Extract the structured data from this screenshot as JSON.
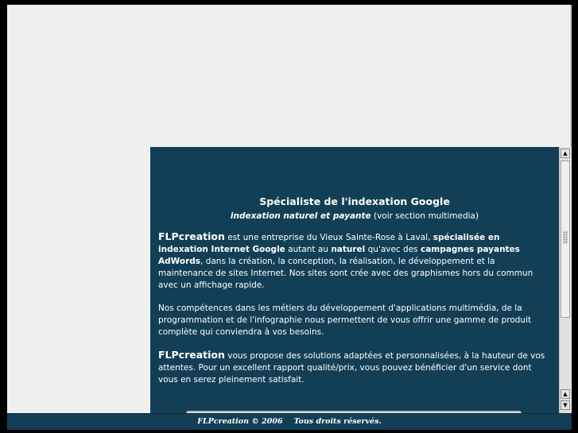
{
  "content": {
    "heading": "Spécialiste de l'indexation Google",
    "subheading_em": "indexation naturel et payante",
    "subheading_rest": " (voir section multimedia)",
    "p1": {
      "brand": "FLPcreation",
      "t1": " est une entreprise du Vieux Sainte-Rose à Laval, ",
      "b1": "spécialisée en indexation Internet Google",
      "t2": " autant au ",
      "b2": "naturel",
      "t3": " qu'avec des ",
      "b3": "campagnes payantes AdWords",
      "t4": ", dans la création, la conception, la réalisation, le développement et la maintenance de sites Internet. Nos sites sont crée avec des graphismes hors du commun avec un affichage rapide."
    },
    "p2": "Nos compétences dans les métiers du développement d'applications multimédia, de la programmation et de l'infographie nous permettent de vous offrir une gamme de produit complète qui conviendra à vos besoins.",
    "p3": {
      "brand": "FLPcreation",
      "text": " vous propose des solutions adaptées et personnalisées, à la hauteur de vos attentes. Pour un excellent rapport qualité/prix, vous pouvez bénéficier d'un service dont vous en serez pleinement satisfait."
    }
  },
  "footer": {
    "copyright": "FLPcreation © 2006",
    "rights": "Tous droits réservés."
  },
  "icons": {
    "scroll_up": "scroll-up-arrow",
    "scroll_down": "scroll-down-arrow"
  },
  "colors": {
    "panel": "#123f55",
    "page": "#efefef",
    "text": "#ffffff"
  }
}
